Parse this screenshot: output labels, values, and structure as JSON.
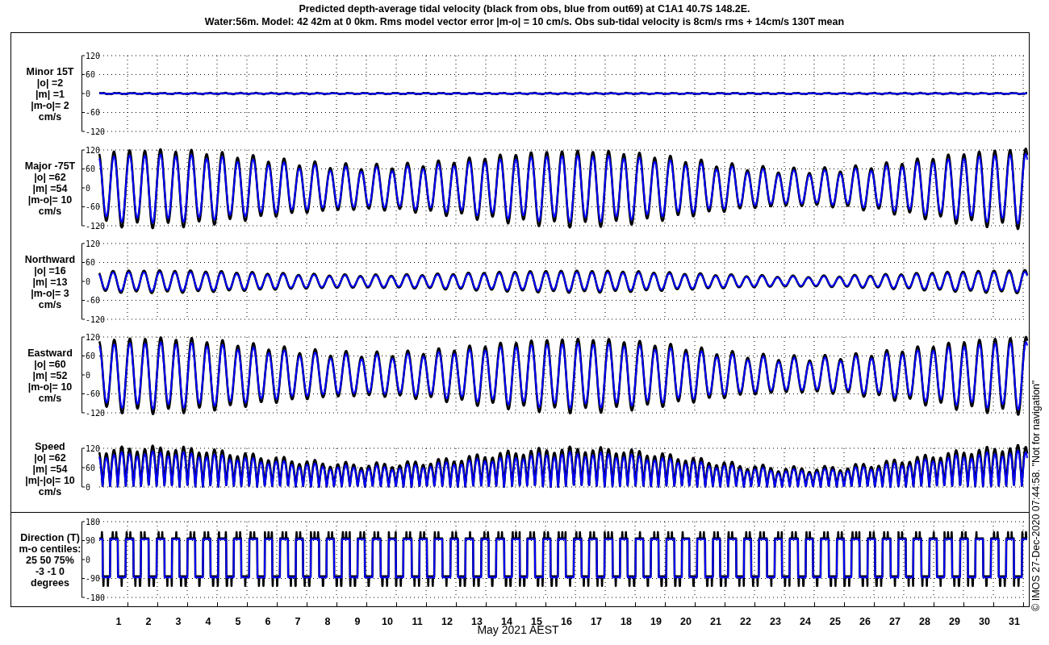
{
  "title_lines": [
    "Predicted depth-average tidal velocity (black from obs, blue from out69) at C1A1 40.7S 148.2E.",
    "Water:56m. Model: 42 42m at 0 0km. Rms model vector error |m-o| = 10 cm/s. Obs sub-tidal velocity is 8cm/s rms + 14cm/s 130T mean"
  ],
  "panels": [
    {
      "kind": "minor",
      "label_lines": [
        "Minor 15T",
        "|o| =2",
        "|m| =1",
        "|m-o|= 2",
        "cm/s"
      ],
      "y_tick_labels": [
        "120",
        "60",
        "0",
        "-60",
        "-120"
      ]
    },
    {
      "kind": "major",
      "label_lines": [
        "Major -75T",
        "|o| =62",
        "|m| =54",
        "|m-o|= 10",
        "cm/s"
      ],
      "y_tick_labels": [
        "120",
        "60",
        "0",
        "-60",
        "-120"
      ]
    },
    {
      "kind": "northward",
      "label_lines": [
        "Northward",
        "|o| =16",
        "|m| =13",
        "|m-o|= 3",
        "cm/s"
      ],
      "y_tick_labels": [
        "120",
        "60",
        "0",
        "-60",
        "-120"
      ]
    },
    {
      "kind": "eastward",
      "label_lines": [
        "Eastward",
        "|o| =60",
        "|m| =52",
        "|m-o|= 10",
        "cm/s"
      ],
      "y_tick_labels": [
        "120",
        "60",
        "0",
        "-60",
        "-120"
      ]
    },
    {
      "kind": "speed",
      "label_lines": [
        "Speed",
        "|o| =62",
        "|m| =54",
        "|m|-|o|= 10",
        "cm/s"
      ],
      "y_tick_labels": [
        "120",
        "60",
        "0"
      ]
    },
    {
      "kind": "direction",
      "label_lines": [
        "Direction (T)",
        "m-o centiles:",
        "25  50  75%",
        "-3 -1  0",
        "degrees"
      ],
      "y_tick_labels": [
        "180",
        "90",
        "0",
        "-90",
        "-180"
      ]
    }
  ],
  "x_tick_labels": [
    "1",
    "2",
    "3",
    "4",
    "5",
    "6",
    "7",
    "8",
    "9",
    "10",
    "11",
    "12",
    "13",
    "14",
    "15",
    "16",
    "17",
    "18",
    "19",
    "20",
    "21",
    "22",
    "23",
    "24",
    "25",
    "26",
    "27",
    "28",
    "29",
    "30",
    "31"
  ],
  "x_axis_title": "May 2021 AEST",
  "credit": "© IMOS 27-Dec-2020 07:44:58. \"Not for navigation\""
}
